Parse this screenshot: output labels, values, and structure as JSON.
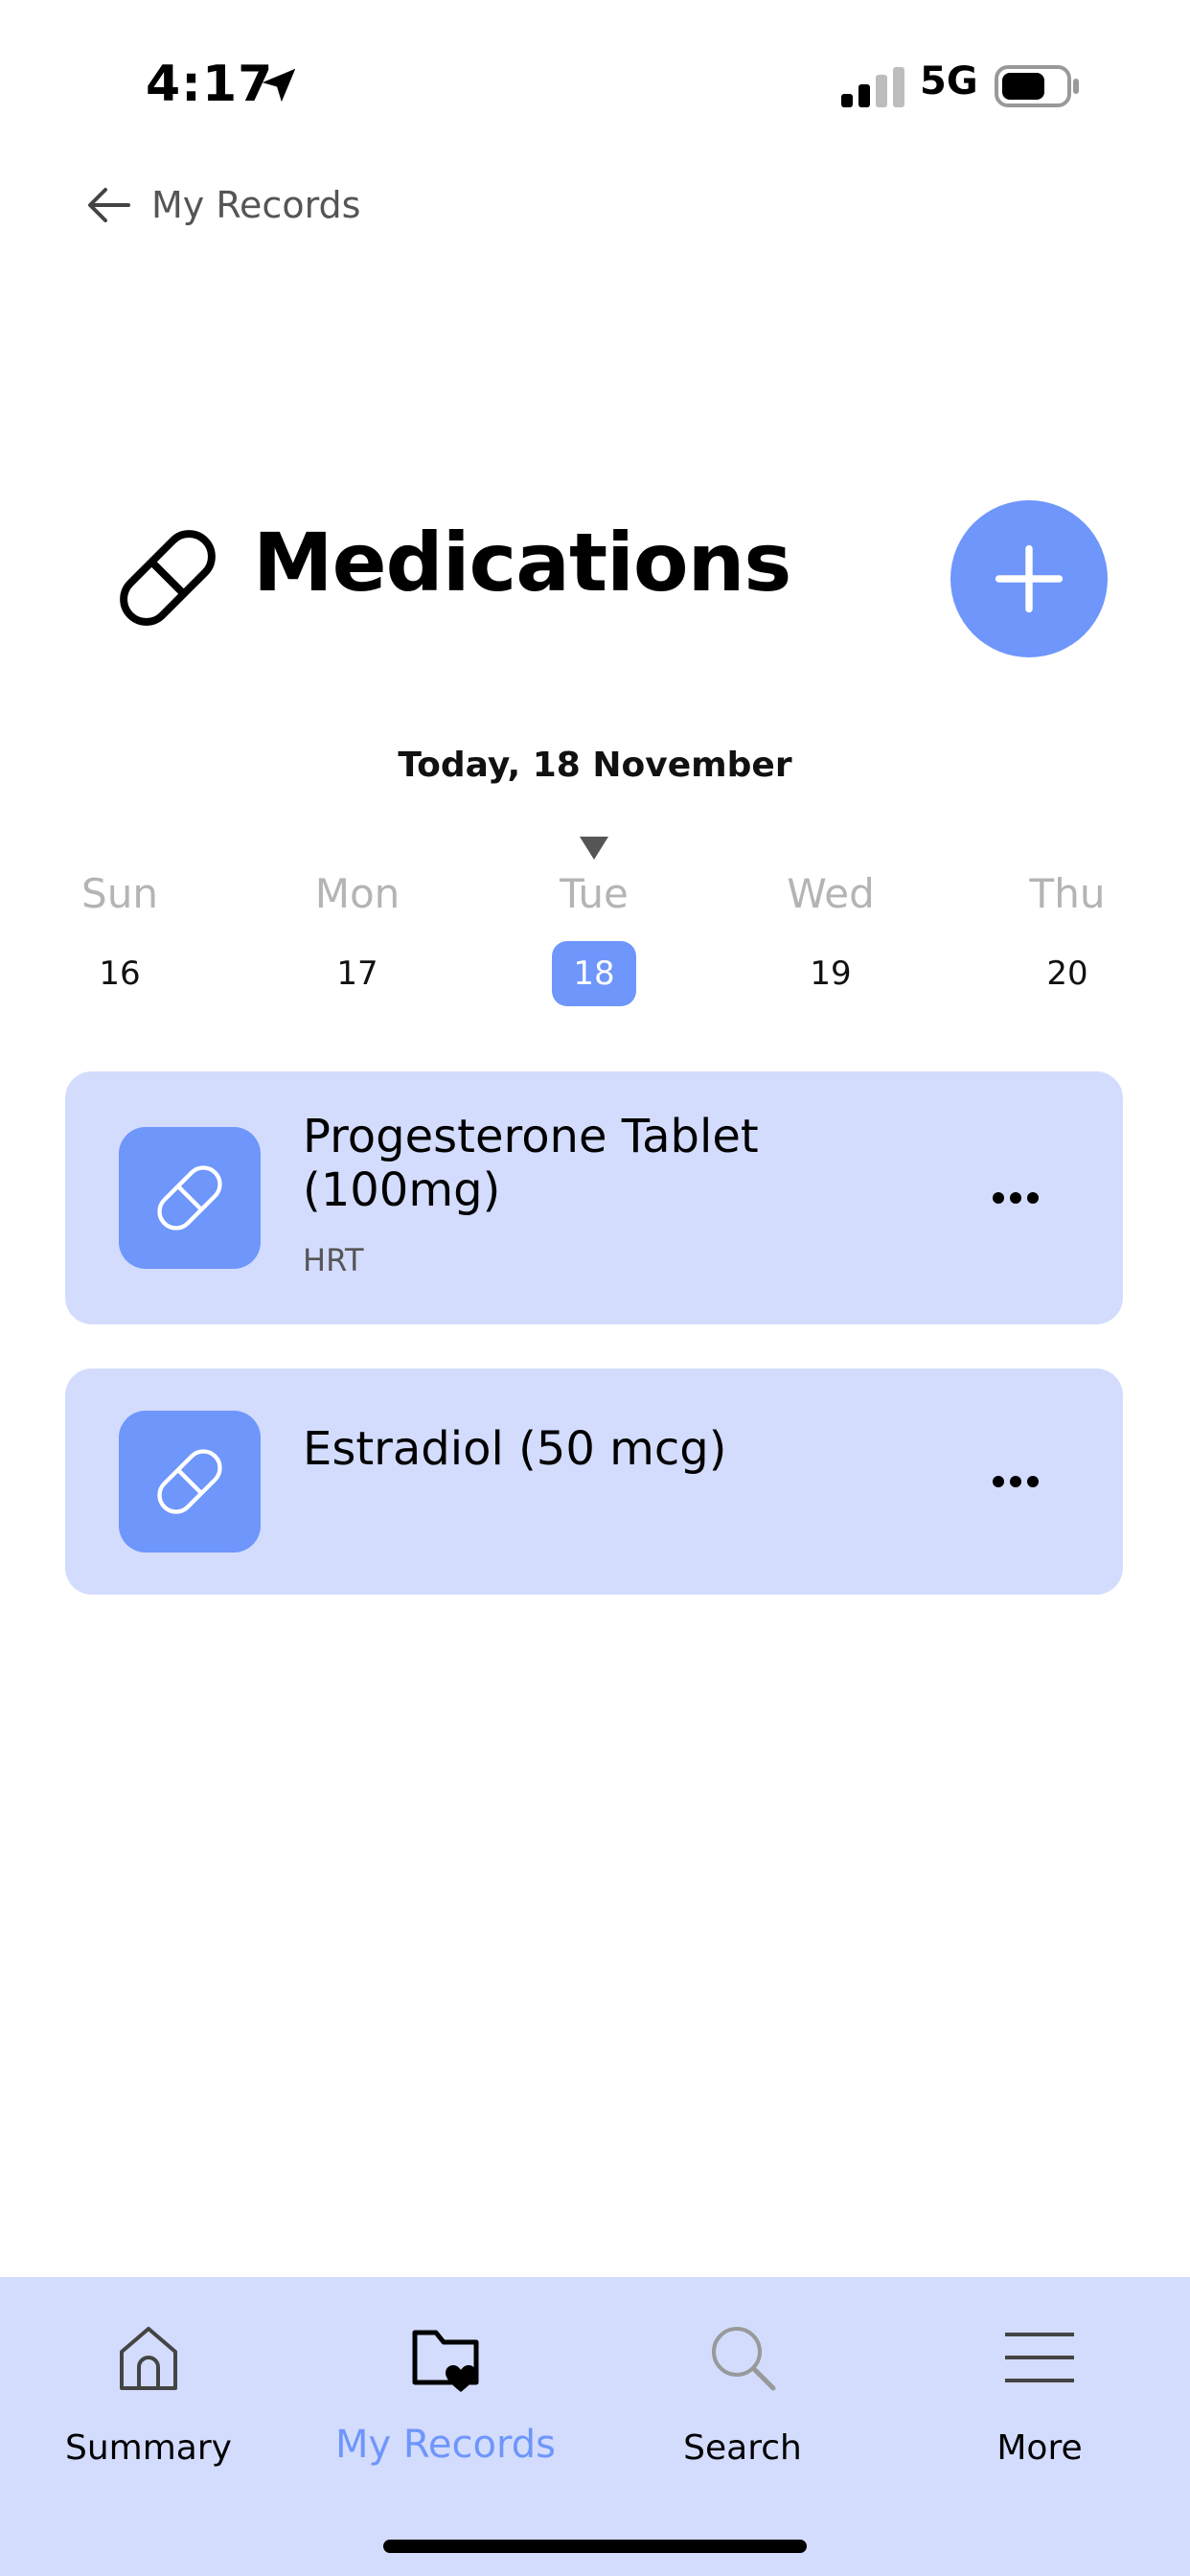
{
  "status_bar": {
    "time": "4:17",
    "network": "5G"
  },
  "back": {
    "label": "My Records"
  },
  "header": {
    "title": "Medications"
  },
  "date": {
    "today_label": "Today, 18 November",
    "days": [
      {
        "name": "Sun",
        "num": "16"
      },
      {
        "name": "Mon",
        "num": "17"
      },
      {
        "name": "Tue",
        "num": "18"
      },
      {
        "name": "Wed",
        "num": "19"
      },
      {
        "name": "Thu",
        "num": "20"
      }
    ],
    "selected": "18"
  },
  "medications": [
    {
      "title": "Progesterone Tablet (100mg)",
      "subtitle": "HRT"
    },
    {
      "title": "Estradiol (50 mcg)",
      "subtitle": ""
    }
  ],
  "nav": {
    "items": [
      {
        "label": "Summary",
        "icon": "home-icon"
      },
      {
        "label": "My Records",
        "icon": "folder-heart-icon"
      },
      {
        "label": "Search",
        "icon": "search-icon"
      },
      {
        "label": "More",
        "icon": "menu-icon"
      }
    ],
    "active": "My Records"
  },
  "colors": {
    "accent": "#6e96fb",
    "card_bg": "#d3dcfd",
    "muted": "#b4b4b4"
  }
}
